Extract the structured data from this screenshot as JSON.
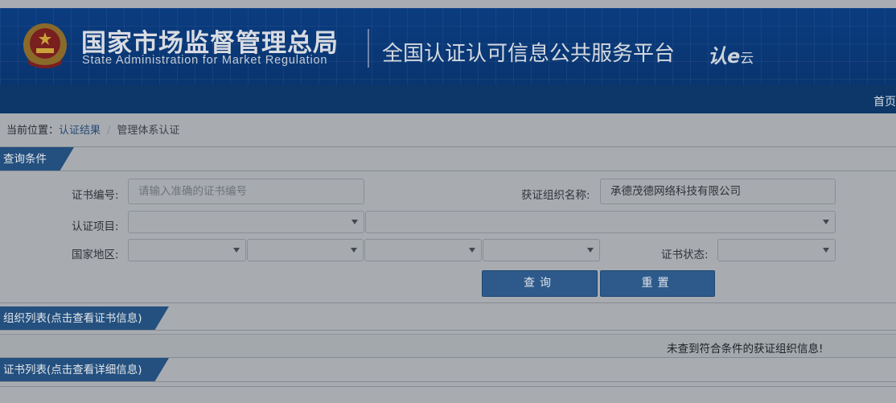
{
  "header": {
    "org_cn": "国家市场监督管理总局",
    "org_en": "State Administration  for  Market Regulation",
    "platform_title": "全国认证认可信息公共服务平台",
    "logo_text_main": "认e",
    "logo_text_small": "云"
  },
  "nav": {
    "home": "首页"
  },
  "breadcrumb": {
    "prefix": "当前位置：",
    "link": "认证结果",
    "separator": "/",
    "current": "管理体系认证"
  },
  "query": {
    "section_title": "查询条件",
    "cert_no_label": "证书编号:",
    "cert_no_placeholder": "请输入准确的证书编号",
    "org_name_label": "获证组织名称:",
    "org_name_value": "承德茂德网络科技有限公司",
    "project_label": "认证项目:",
    "region_label": "国家地区:",
    "status_label": "证书状态:",
    "search_button": "查询",
    "reset_button": "重置"
  },
  "org_list": {
    "section_title": "组织列表(点击查看证书信息)",
    "empty_message": "未查到符合条件的获证组织信息!"
  },
  "cert_list": {
    "section_title": "证书列表(点击查看详细信息)"
  },
  "icons": [
    "national-emblem-icon",
    "dropdown-arrow-icon"
  ],
  "colors": {
    "header_bg": "#0a3a78",
    "nav_bg": "#0c3768",
    "section_tab": "#23507f",
    "button": "#2d5a8a",
    "overlay_page": "#a8acb1"
  }
}
